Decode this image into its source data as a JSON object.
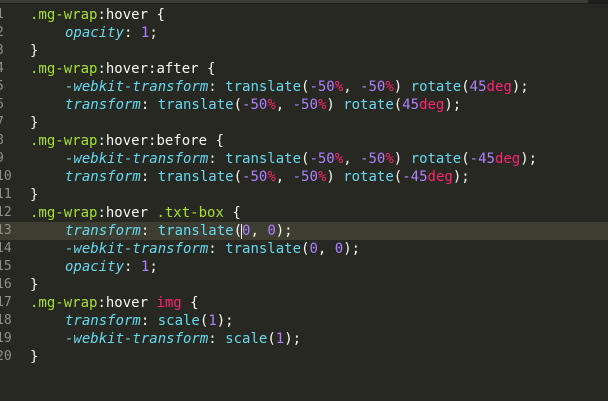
{
  "editor": {
    "lines": [
      {
        "ln": "1",
        "active": false,
        "indent": false,
        "tokens": [
          {
            "t": "sel",
            "v": ".mg-wrap"
          },
          {
            "t": "plain",
            "v": ":hover {"
          }
        ]
      },
      {
        "ln": "2",
        "active": false,
        "indent": true,
        "tokens": [
          {
            "t": "prop",
            "v": "opacity"
          },
          {
            "t": "plain",
            "v": ": "
          },
          {
            "t": "num",
            "v": "1"
          },
          {
            "t": "plain",
            "v": ";"
          }
        ]
      },
      {
        "ln": "3",
        "active": false,
        "indent": false,
        "tokens": [
          {
            "t": "plain",
            "v": "}"
          }
        ]
      },
      {
        "ln": "4",
        "active": false,
        "indent": false,
        "tokens": [
          {
            "t": "sel",
            "v": ".mg-wrap"
          },
          {
            "t": "plain",
            "v": ":hover:after {"
          }
        ]
      },
      {
        "ln": "5",
        "active": false,
        "indent": true,
        "tokens": [
          {
            "t": "prop",
            "v": "-webkit-transform"
          },
          {
            "t": "plain",
            "v": ": "
          },
          {
            "t": "fn",
            "v": "translate"
          },
          {
            "t": "plain",
            "v": "("
          },
          {
            "t": "num",
            "v": "-50"
          },
          {
            "t": "unit",
            "v": "%"
          },
          {
            "t": "plain",
            "v": ", "
          },
          {
            "t": "num",
            "v": "-50"
          },
          {
            "t": "unit",
            "v": "%"
          },
          {
            "t": "plain",
            "v": ") "
          },
          {
            "t": "fn",
            "v": "rotate"
          },
          {
            "t": "plain",
            "v": "("
          },
          {
            "t": "num",
            "v": "45"
          },
          {
            "t": "unit",
            "v": "deg"
          },
          {
            "t": "plain",
            "v": ");"
          }
        ]
      },
      {
        "ln": "6",
        "active": false,
        "indent": true,
        "tokens": [
          {
            "t": "prop",
            "v": "transform"
          },
          {
            "t": "plain",
            "v": ": "
          },
          {
            "t": "fn",
            "v": "translate"
          },
          {
            "t": "plain",
            "v": "("
          },
          {
            "t": "num",
            "v": "-50"
          },
          {
            "t": "unit",
            "v": "%"
          },
          {
            "t": "plain",
            "v": ", "
          },
          {
            "t": "num",
            "v": "-50"
          },
          {
            "t": "unit",
            "v": "%"
          },
          {
            "t": "plain",
            "v": ") "
          },
          {
            "t": "fn",
            "v": "rotate"
          },
          {
            "t": "plain",
            "v": "("
          },
          {
            "t": "num",
            "v": "45"
          },
          {
            "t": "unit",
            "v": "deg"
          },
          {
            "t": "plain",
            "v": ");"
          }
        ]
      },
      {
        "ln": "7",
        "active": false,
        "indent": false,
        "tokens": [
          {
            "t": "plain",
            "v": "}"
          }
        ]
      },
      {
        "ln": "8",
        "active": false,
        "indent": false,
        "tokens": [
          {
            "t": "sel",
            "v": ".mg-wrap"
          },
          {
            "t": "plain",
            "v": ":hover:before {"
          }
        ]
      },
      {
        "ln": "9",
        "active": false,
        "indent": true,
        "tokens": [
          {
            "t": "prop",
            "v": "-webkit-transform"
          },
          {
            "t": "plain",
            "v": ": "
          },
          {
            "t": "fn",
            "v": "translate"
          },
          {
            "t": "plain",
            "v": "("
          },
          {
            "t": "num",
            "v": "-50"
          },
          {
            "t": "unit",
            "v": "%"
          },
          {
            "t": "plain",
            "v": ", "
          },
          {
            "t": "num",
            "v": "-50"
          },
          {
            "t": "unit",
            "v": "%"
          },
          {
            "t": "plain",
            "v": ") "
          },
          {
            "t": "fn",
            "v": "rotate"
          },
          {
            "t": "plain",
            "v": "("
          },
          {
            "t": "num",
            "v": "-45"
          },
          {
            "t": "unit",
            "v": "deg"
          },
          {
            "t": "plain",
            "v": ");"
          }
        ]
      },
      {
        "ln": "10",
        "active": false,
        "indent": true,
        "tokens": [
          {
            "t": "prop",
            "v": "transform"
          },
          {
            "t": "plain",
            "v": ": "
          },
          {
            "t": "fn",
            "v": "translate"
          },
          {
            "t": "plain",
            "v": "("
          },
          {
            "t": "num",
            "v": "-50"
          },
          {
            "t": "unit",
            "v": "%"
          },
          {
            "t": "plain",
            "v": ", "
          },
          {
            "t": "num",
            "v": "-50"
          },
          {
            "t": "unit",
            "v": "%"
          },
          {
            "t": "plain",
            "v": ") "
          },
          {
            "t": "fn",
            "v": "rotate"
          },
          {
            "t": "plain",
            "v": "("
          },
          {
            "t": "num",
            "v": "-45"
          },
          {
            "t": "unit",
            "v": "deg"
          },
          {
            "t": "plain",
            "v": ");"
          }
        ]
      },
      {
        "ln": "11",
        "active": false,
        "indent": false,
        "tokens": [
          {
            "t": "plain",
            "v": "}"
          }
        ]
      },
      {
        "ln": "12",
        "active": false,
        "indent": false,
        "tokens": [
          {
            "t": "sel",
            "v": ".mg-wrap"
          },
          {
            "t": "plain",
            "v": ":hover "
          },
          {
            "t": "sel",
            "v": ".txt-box"
          },
          {
            "t": "plain",
            "v": " {"
          }
        ]
      },
      {
        "ln": "13",
        "active": true,
        "indent": true,
        "tokens": [
          {
            "t": "prop",
            "v": "transform"
          },
          {
            "t": "plain",
            "v": ": "
          },
          {
            "t": "fn",
            "v": "translate"
          },
          {
            "t": "plain",
            "v": "("
          },
          {
            "t": "caret",
            "v": ""
          },
          {
            "t": "num",
            "v": "0"
          },
          {
            "t": "plain",
            "v": ", "
          },
          {
            "t": "num",
            "v": "0"
          },
          {
            "t": "plain",
            "v": ");"
          }
        ]
      },
      {
        "ln": "14",
        "active": false,
        "indent": true,
        "tokens": [
          {
            "t": "prop",
            "v": "-webkit-transform"
          },
          {
            "t": "plain",
            "v": ": "
          },
          {
            "t": "fn",
            "v": "translate"
          },
          {
            "t": "plain",
            "v": "("
          },
          {
            "t": "num",
            "v": "0"
          },
          {
            "t": "plain",
            "v": ", "
          },
          {
            "t": "num",
            "v": "0"
          },
          {
            "t": "plain",
            "v": ");"
          }
        ]
      },
      {
        "ln": "15",
        "active": false,
        "indent": true,
        "tokens": [
          {
            "t": "prop",
            "v": "opacity"
          },
          {
            "t": "plain",
            "v": ": "
          },
          {
            "t": "num",
            "v": "1"
          },
          {
            "t": "plain",
            "v": ";"
          }
        ]
      },
      {
        "ln": "16",
        "active": false,
        "indent": false,
        "tokens": [
          {
            "t": "plain",
            "v": "}"
          }
        ]
      },
      {
        "ln": "17",
        "active": false,
        "indent": false,
        "tokens": [
          {
            "t": "sel",
            "v": ".mg-wrap"
          },
          {
            "t": "plain",
            "v": ":hover "
          },
          {
            "t": "tag",
            "v": "img"
          },
          {
            "t": "plain",
            "v": " {"
          }
        ]
      },
      {
        "ln": "18",
        "active": false,
        "indent": true,
        "tokens": [
          {
            "t": "prop",
            "v": "transform"
          },
          {
            "t": "plain",
            "v": ": "
          },
          {
            "t": "fn",
            "v": "scale"
          },
          {
            "t": "plain",
            "v": "("
          },
          {
            "t": "num",
            "v": "1"
          },
          {
            "t": "plain",
            "v": ");"
          }
        ]
      },
      {
        "ln": "19",
        "active": false,
        "indent": true,
        "tokens": [
          {
            "t": "prop",
            "v": "-webkit-transform"
          },
          {
            "t": "plain",
            "v": ": "
          },
          {
            "t": "fn",
            "v": "scale"
          },
          {
            "t": "plain",
            "v": "("
          },
          {
            "t": "num",
            "v": "1"
          },
          {
            "t": "plain",
            "v": ");"
          }
        ]
      },
      {
        "ln": "20",
        "active": false,
        "indent": false,
        "tokens": [
          {
            "t": "plain",
            "v": "}"
          }
        ]
      }
    ]
  },
  "colors": {
    "background": "#272822",
    "selector": "#a6e22e",
    "property": "#66d9ef",
    "number": "#ae81ff",
    "unit": "#f92672",
    "text": "#f8f8f2",
    "active_line": "#3e3d32"
  }
}
